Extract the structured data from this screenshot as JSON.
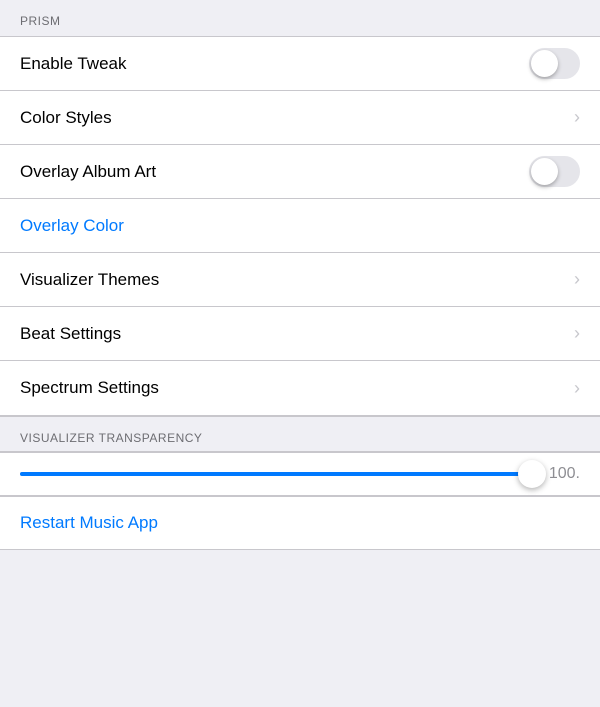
{
  "prism": {
    "section_header": "PRISM",
    "rows": [
      {
        "id": "enable-tweak",
        "label": "Enable Tweak",
        "type": "toggle",
        "value": false
      },
      {
        "id": "color-styles",
        "label": "Color Styles",
        "type": "chevron"
      },
      {
        "id": "overlay-album-art",
        "label": "Overlay Album Art",
        "type": "toggle",
        "value": false
      },
      {
        "id": "overlay-color",
        "label": "Overlay Color",
        "type": "plain",
        "style": "blue"
      },
      {
        "id": "visualizer-themes",
        "label": "Visualizer Themes",
        "type": "chevron"
      },
      {
        "id": "beat-settings",
        "label": "Beat Settings",
        "type": "chevron"
      },
      {
        "id": "spectrum-settings",
        "label": "Spectrum Settings",
        "type": "chevron"
      }
    ]
  },
  "visualizer_transparency": {
    "section_header": "VISUALIZER TRANSPARENCY",
    "slider_value": "100.",
    "slider_percent": 100
  },
  "restart": {
    "label": "Restart Music App"
  },
  "chevron_symbol": "›"
}
